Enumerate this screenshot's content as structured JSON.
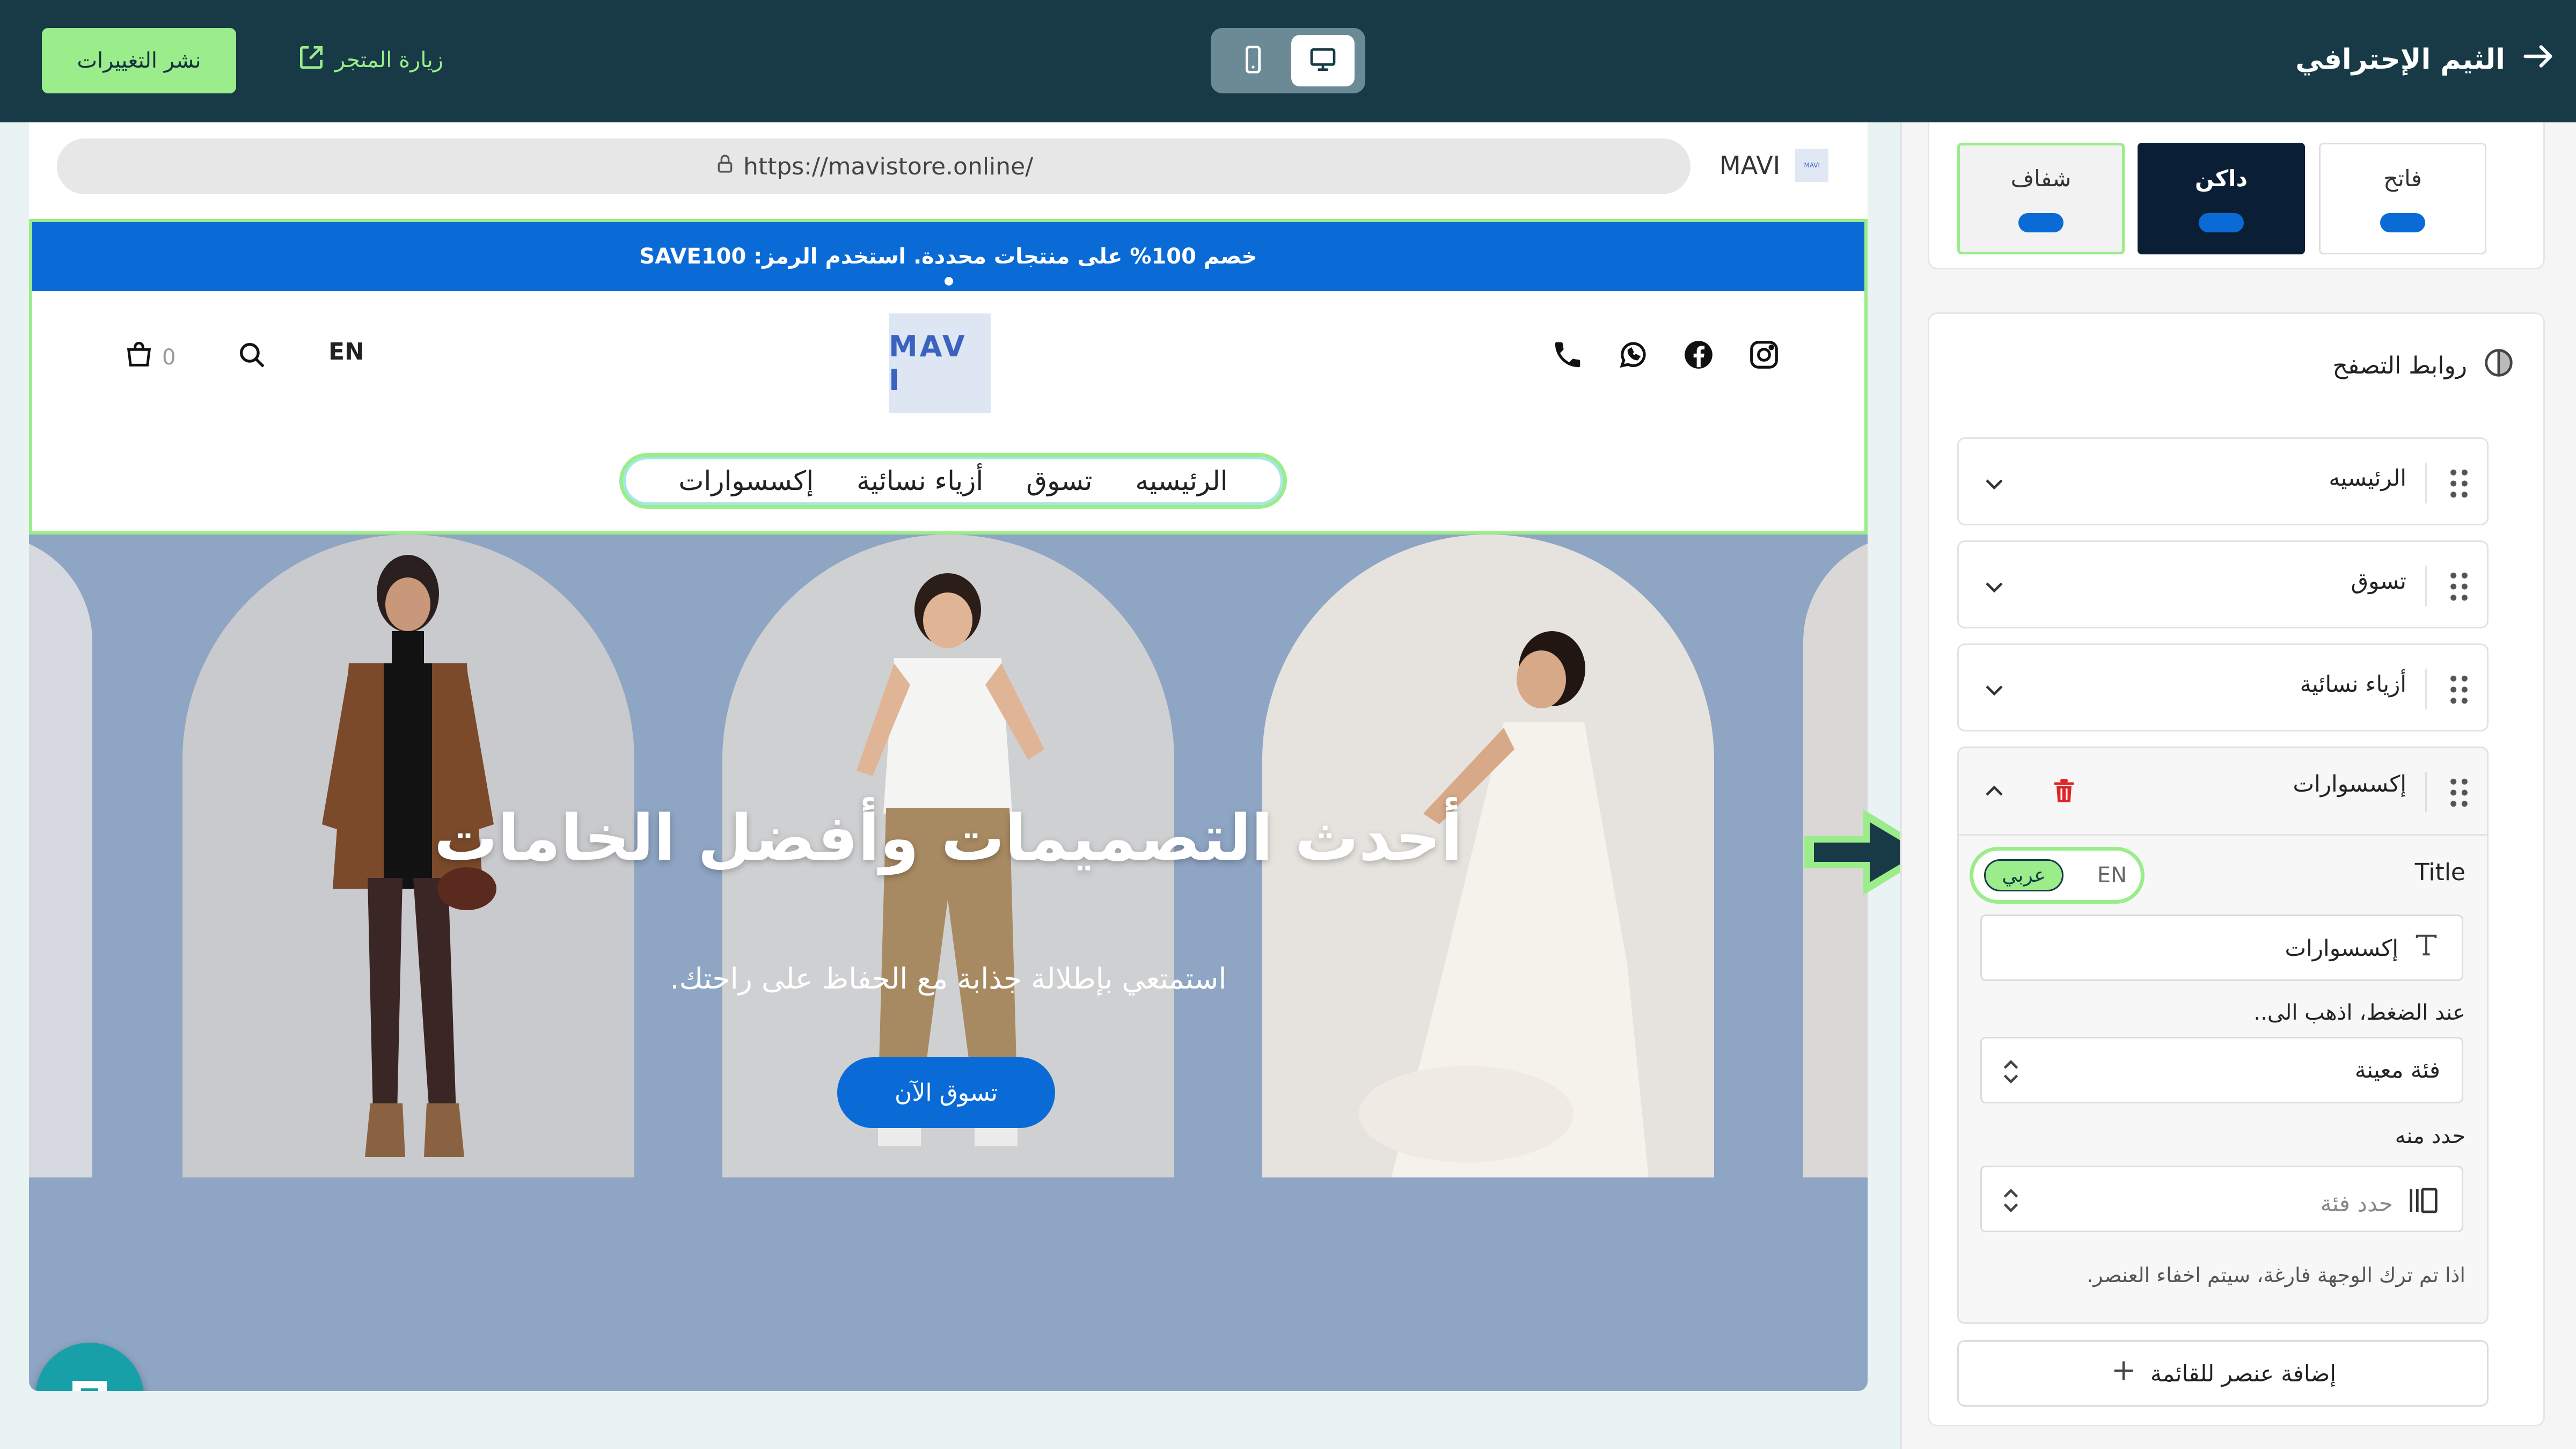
{
  "topbar": {
    "publish_label": "نشر التغييرات",
    "visit_store_label": "زيارة المتجر",
    "theme_title": "الثيم الإحترافي",
    "device_options": [
      "mobile",
      "desktop"
    ],
    "active_device": "desktop"
  },
  "preview": {
    "url": "https://mavistore.online/",
    "store_name": "MAVI",
    "announcement": "خصم 100% على منتجات محددة. استخدم الرمز: SAVE100",
    "cart_count": "0",
    "language_toggle": "EN",
    "logo_text": "MAV I",
    "nav_links": [
      "الرئيسيه",
      "تسوق",
      "أزياء نسائية",
      "إكسسوارات"
    ],
    "hero_title": "أحدث التصميمات وأفضل الخامات",
    "hero_subtitle": "استمتعي بإطلالة جذابة مع الحفاظ على راحتك.",
    "hero_button": "تسوق الآن",
    "social_icons": [
      "phone-icon",
      "whatsapp-icon",
      "facebook-icon",
      "instagram-icon"
    ]
  },
  "panel": {
    "modes": {
      "transparent": "شفاف",
      "dark": "داكن",
      "light": "فاتح",
      "selected": "transparent"
    },
    "links_section_title": "روابط التصفح",
    "links": [
      {
        "label": "الرئيسيه"
      },
      {
        "label": "تسوق"
      },
      {
        "label": "أزياء نسائية"
      }
    ],
    "expanded_link": {
      "label": "إكسسوارات",
      "title_label": "Title",
      "lang_en": "EN",
      "lang_ar": "عربي",
      "title_value": "إكسسوارات",
      "on_click_label": "عند الضغط، اذهب الى..",
      "on_click_value": "فئة معينة",
      "select_from_label": "حدد منه",
      "select_placeholder": "حدد فئة",
      "hint": "اذا تم ترك الوجهة فارغة، سيتم اخفاء العنصر."
    },
    "add_item_label": "إضافة عنصر للقائمة"
  },
  "colors": {
    "topbar_bg": "#173a46",
    "accent_green": "#9aed8a",
    "brand_blue": "#0b6bd6",
    "danger_red": "#e02424",
    "hero_bg": "#8ea5c3"
  }
}
